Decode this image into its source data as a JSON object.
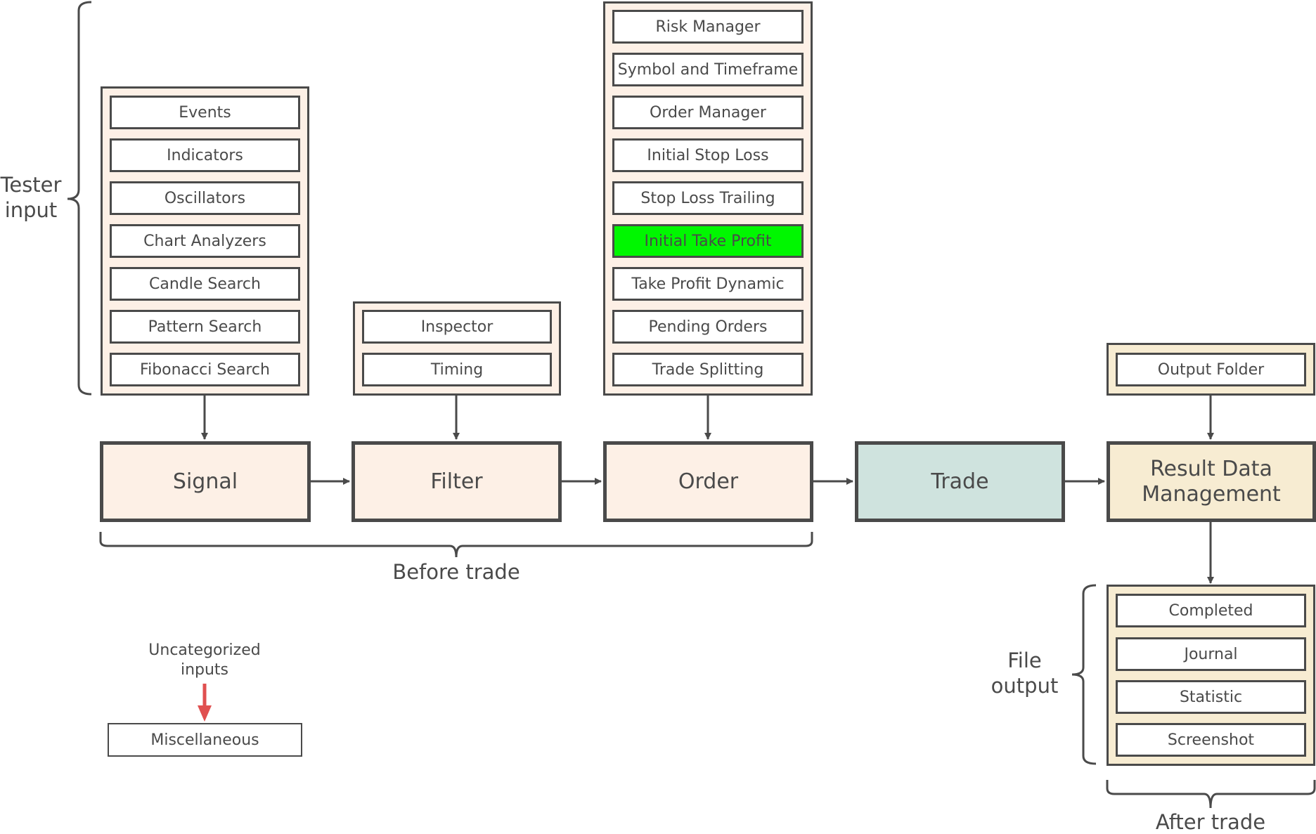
{
  "tester_input": {
    "label": "Tester input",
    "items": [
      "Events",
      "Indicators",
      "Oscillators",
      "Chart Analyzers",
      "Candle Search",
      "Pattern Search",
      "Fibonacci Search"
    ]
  },
  "filter_input": {
    "items": [
      "Inspector",
      "Timing"
    ]
  },
  "order_input": {
    "items": [
      "Risk Manager",
      "Symbol and Timeframe",
      "Order Manager",
      "Initial Stop Loss",
      "Stop Loss Trailing",
      "Initial Take Profit",
      "Take Profit Dynamic",
      "Pending Orders",
      "Trade Splitting"
    ],
    "highlighted": "Initial Take Profit"
  },
  "output_folder": {
    "items": [
      "Output Folder"
    ]
  },
  "stages": {
    "signal": "Signal",
    "filter": "Filter",
    "order": "Order",
    "trade": "Trade",
    "result_line1": "Result Data",
    "result_line2": "Management"
  },
  "brackets": {
    "before_trade": "Before trade",
    "after_trade": "After trade",
    "file_output_line1": "File",
    "file_output_line2": "output",
    "tester_input_line1": "Tester",
    "tester_input_line2": "input"
  },
  "file_output": {
    "items": [
      "Completed",
      "Journal",
      "Statistic",
      "Screenshot"
    ]
  },
  "uncategorized": {
    "label_line1": "Uncategorized",
    "label_line2": "inputs",
    "box": "Miscellaneous"
  },
  "colors": {
    "peach": "#fdf0e6",
    "cream": "#f7ecd2",
    "teal": "#cfe3de",
    "highlight": "#00f700",
    "stroke": "#4a4a4a",
    "red_arrow": "#e05050"
  }
}
